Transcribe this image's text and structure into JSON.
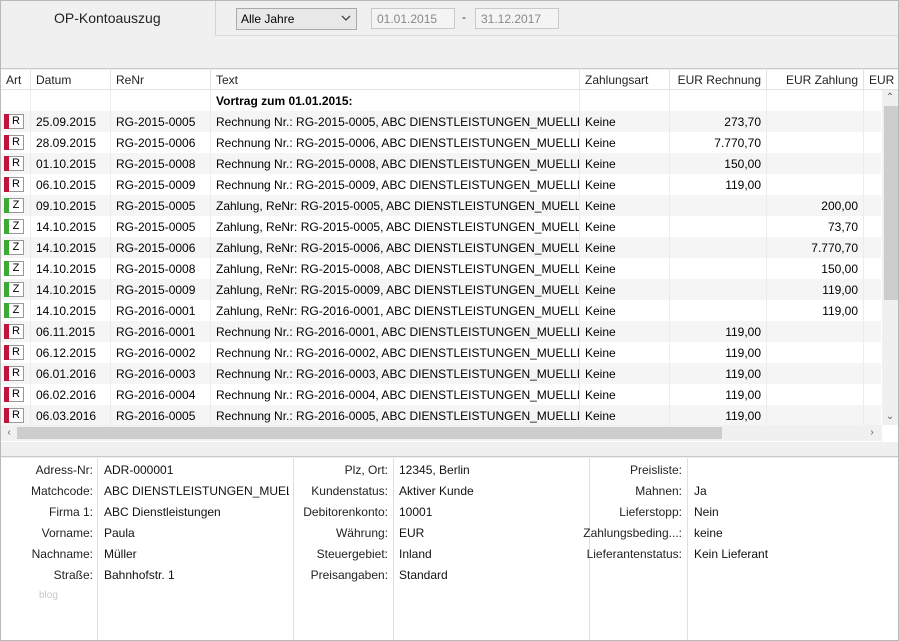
{
  "header": {
    "title": "OP-Kontoauszug",
    "period_select": "Alle Jahre",
    "date_from": "01.01.2015",
    "date_separator": "-",
    "date_to": "31.12.2017"
  },
  "grid": {
    "columns": {
      "art": "Art",
      "datum": "Datum",
      "renr": "ReNr",
      "text": "Text",
      "zahlungsart": "Zahlungsart",
      "eur_rechnung": "EUR Rechnung",
      "eur_zahlung": "EUR Zahlung",
      "eur_more": "EUR N"
    },
    "carry_forward": "Vortrag zum 01.01.2015:",
    "rows": [
      {
        "art": "R",
        "datum": "25.09.2015",
        "renr": "RG-2015-0005",
        "text": "Rechnung Nr.: RG-2015-0005, ABC DIENSTLEISTUNGEN_MUELLER_...",
        "zahlungsart": "Keine",
        "rechnung": "273,70",
        "zahlung": ""
      },
      {
        "art": "R",
        "datum": "28.09.2015",
        "renr": "RG-2015-0006",
        "text": "Rechnung Nr.: RG-2015-0006, ABC DIENSTLEISTUNGEN_MUELLER_...",
        "zahlungsart": "Keine",
        "rechnung": "7.770,70",
        "zahlung": ""
      },
      {
        "art": "R",
        "datum": "01.10.2015",
        "renr": "RG-2015-0008",
        "text": "Rechnung Nr.: RG-2015-0008, ABC DIENSTLEISTUNGEN_MUELLER_...",
        "zahlungsart": "Keine",
        "rechnung": "150,00",
        "zahlung": ""
      },
      {
        "art": "R",
        "datum": "06.10.2015",
        "renr": "RG-2015-0009",
        "text": "Rechnung Nr.: RG-2015-0009, ABC DIENSTLEISTUNGEN_MUELLER_...",
        "zahlungsart": "Keine",
        "rechnung": "119,00",
        "zahlung": ""
      },
      {
        "art": "Z",
        "datum": "09.10.2015",
        "renr": "RG-2015-0005",
        "text": "Zahlung, ReNr: RG-2015-0005, ABC DIENSTLEISTUNGEN_MUELLER_...",
        "zahlungsart": "Keine",
        "rechnung": "",
        "zahlung": "200,00"
      },
      {
        "art": "Z",
        "datum": "14.10.2015",
        "renr": "RG-2015-0005",
        "text": "Zahlung, ReNr: RG-2015-0005, ABC DIENSTLEISTUNGEN_MUELLER_...",
        "zahlungsart": "Keine",
        "rechnung": "",
        "zahlung": "73,70"
      },
      {
        "art": "Z",
        "datum": "14.10.2015",
        "renr": "RG-2015-0006",
        "text": "Zahlung, ReNr: RG-2015-0006, ABC DIENSTLEISTUNGEN_MUELLER_...",
        "zahlungsart": "Keine",
        "rechnung": "",
        "zahlung": "7.770,70"
      },
      {
        "art": "Z",
        "datum": "14.10.2015",
        "renr": "RG-2015-0008",
        "text": "Zahlung, ReNr: RG-2015-0008, ABC DIENSTLEISTUNGEN_MUELLER_...",
        "zahlungsart": "Keine",
        "rechnung": "",
        "zahlung": "150,00"
      },
      {
        "art": "Z",
        "datum": "14.10.2015",
        "renr": "RG-2015-0009",
        "text": "Zahlung, ReNr: RG-2015-0009, ABC DIENSTLEISTUNGEN_MUELLER_...",
        "zahlungsart": "Keine",
        "rechnung": "",
        "zahlung": "119,00"
      },
      {
        "art": "Z",
        "datum": "14.10.2015",
        "renr": "RG-2016-0001",
        "text": "Zahlung, ReNr: RG-2016-0001, ABC DIENSTLEISTUNGEN_MUELLER_...",
        "zahlungsart": "Keine",
        "rechnung": "",
        "zahlung": "119,00"
      },
      {
        "art": "R",
        "datum": "06.11.2015",
        "renr": "RG-2016-0001",
        "text": "Rechnung Nr.: RG-2016-0001, ABC DIENSTLEISTUNGEN_MUELLER_...",
        "zahlungsart": "Keine",
        "rechnung": "119,00",
        "zahlung": ""
      },
      {
        "art": "R",
        "datum": "06.12.2015",
        "renr": "RG-2016-0002",
        "text": "Rechnung Nr.: RG-2016-0002, ABC DIENSTLEISTUNGEN_MUELLER_...",
        "zahlungsart": "Keine",
        "rechnung": "119,00",
        "zahlung": ""
      },
      {
        "art": "R",
        "datum": "06.01.2016",
        "renr": "RG-2016-0003",
        "text": "Rechnung Nr.: RG-2016-0003, ABC DIENSTLEISTUNGEN_MUELLER_...",
        "zahlungsart": "Keine",
        "rechnung": "119,00",
        "zahlung": ""
      },
      {
        "art": "R",
        "datum": "06.02.2016",
        "renr": "RG-2016-0004",
        "text": "Rechnung Nr.: RG-2016-0004, ABC DIENSTLEISTUNGEN_MUELLER_...",
        "zahlungsart": "Keine",
        "rechnung": "119,00",
        "zahlung": ""
      },
      {
        "art": "R",
        "datum": "06.03.2016",
        "renr": "RG-2016-0005",
        "text": "Rechnung Nr.: RG-2016-0005, ABC DIENSTLEISTUNGEN_MUELLER_...",
        "zahlungsart": "Keine",
        "rechnung": "119,00",
        "zahlung": ""
      }
    ]
  },
  "details": {
    "col1": [
      {
        "label": "Adress-Nr:",
        "value": "ADR-000001"
      },
      {
        "label": "Matchcode:",
        "value": "ABC DIENSTLEISTUNGEN_MUELL..."
      },
      {
        "label": "Firma 1:",
        "value": "ABC Dienstleistungen"
      },
      {
        "label": "Vorname:",
        "value": "Paula"
      },
      {
        "label": "Nachname:",
        "value": "Müller"
      },
      {
        "label": "Straße:",
        "value": "Bahnhofstr. 1"
      }
    ],
    "col2": [
      {
        "label": "Plz, Ort:",
        "value": "12345, Berlin"
      },
      {
        "label": "Kundenstatus:",
        "value": "Aktiver Kunde"
      },
      {
        "label": "Debitorenkonto:",
        "value": "10001"
      },
      {
        "label": "Währung:",
        "value": "EUR"
      },
      {
        "label": "Steuergebiet:",
        "value": "Inland"
      },
      {
        "label": "Preisangaben:",
        "value": "Standard"
      }
    ],
    "col3": [
      {
        "label": "Preisliste:",
        "value": ""
      },
      {
        "label": "Mahnen:",
        "value": "Ja"
      },
      {
        "label": "Lieferstopp:",
        "value": "Nein"
      },
      {
        "label": "Zahlungsbeding...:",
        "value": "keine"
      },
      {
        "label": "Lieferantenstatus:",
        "value": "Kein Lieferant"
      }
    ],
    "watermark": "blog"
  },
  "colors": {
    "rechnung_badge": "#c0143c",
    "zahlung_badge": "#3aa935"
  }
}
